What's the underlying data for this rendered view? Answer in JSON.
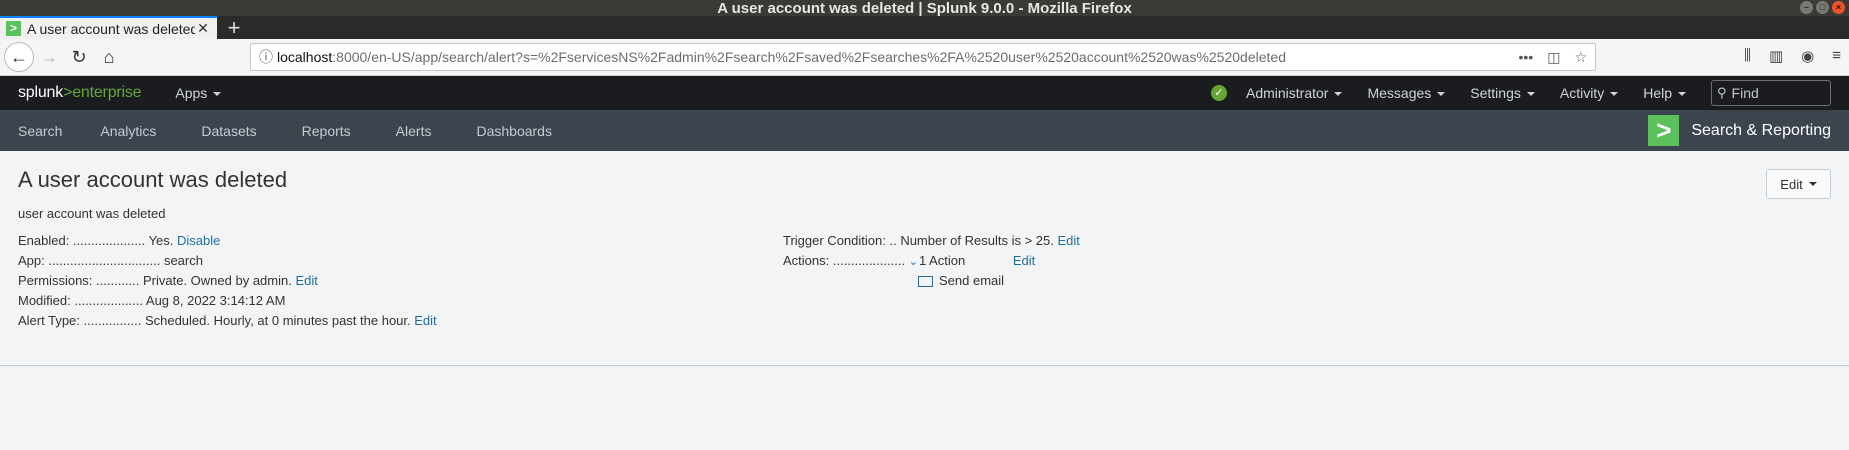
{
  "window": {
    "title": "A user account was deleted | Splunk 9.0.0 - Mozilla Firefox"
  },
  "browser": {
    "tab_title": "A user account was deleted",
    "url_host": "localhost",
    "url_rest": ":8000/en-US/app/search/alert?s=%2FservicesNS%2Fadmin%2Fsearch%2Fsaved%2Fsearches%2FA%2520user%2520account%2520was%2520deleted"
  },
  "splunk": {
    "logo_main": "splunk",
    "logo_sep": ">",
    "logo_product": "enterprise",
    "apps_label": "Apps",
    "menus": [
      "Administrator",
      "Messages",
      "Settings",
      "Activity",
      "Help"
    ],
    "find_placeholder": "Find"
  },
  "appbar": {
    "nav": [
      "Search",
      "Analytics",
      "Datasets",
      "Reports",
      "Alerts",
      "Dashboards"
    ],
    "app_name": "Search & Reporting"
  },
  "alert": {
    "title": "A user account was deleted",
    "description": "user account was deleted",
    "edit_label": "Edit",
    "left": [
      {
        "key": "Enabled: ....................",
        "value": "Yes.",
        "link": "Disable"
      },
      {
        "key": "App: ...............................",
        "value": "search",
        "link": ""
      },
      {
        "key": "Permissions: ............",
        "value": "Private. Owned by admin.",
        "link": "Edit"
      },
      {
        "key": "Modified: ...................",
        "value": "Aug 8, 2022 3:14:12 AM",
        "link": ""
      },
      {
        "key": "Alert Type: ................",
        "value": "Scheduled. Hourly, at 0 minutes past the hour.",
        "link": "Edit"
      }
    ],
    "trigger_key": "Trigger Condition: ..",
    "trigger_value": "Number of Results is > 25.",
    "trigger_link": "Edit",
    "actions_key": "Actions: ....................",
    "actions_value": "1 Action",
    "actions_link": "Edit",
    "action_item": "Send email"
  }
}
